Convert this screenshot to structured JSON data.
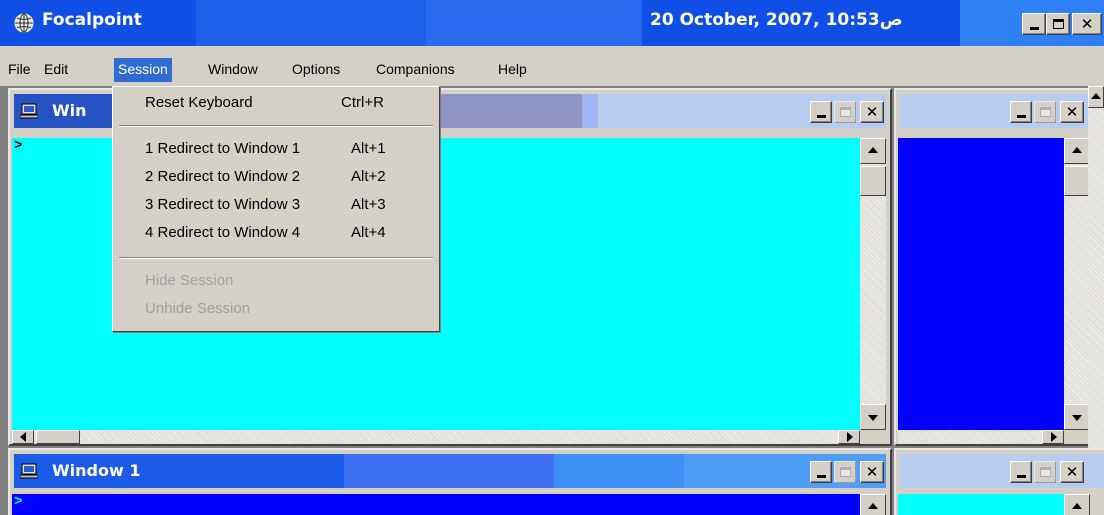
{
  "app": {
    "title": "Focalpoint",
    "clock": "20 October, 2007, ص10:53"
  },
  "menubar": {
    "items": [
      "File",
      "Edit",
      "Session",
      "Window",
      "Options",
      "Companions",
      "Help"
    ]
  },
  "session_menu": {
    "reset_keyboard": {
      "label": "Reset Keyboard",
      "shortcut": "Ctrl+R"
    },
    "redirects": [
      {
        "label": "1 Redirect to Window 1",
        "shortcut": "Alt+1"
      },
      {
        "label": "2 Redirect to Window 2",
        "shortcut": "Alt+2"
      },
      {
        "label": "3 Redirect to Window 3",
        "shortcut": "Alt+3"
      },
      {
        "label": "4 Redirect to Window 4",
        "shortcut": "Alt+4"
      }
    ],
    "hide_session": "Hide Session",
    "unhide_session": "Unhide Session"
  },
  "windows": {
    "top_left": {
      "title": "Win",
      "prompt": ">"
    },
    "bottom_left": {
      "title": "Window 1",
      "prompt": ">"
    }
  },
  "colors": {
    "title_blue": "#1c5be8",
    "cyan_client": "#00ffff",
    "blue_client": "#0000ff",
    "menu_highlight": "#306bd2"
  },
  "icons": [
    "focalpoint-globe-icon",
    "computer-icon",
    "minimize-icon",
    "maximize-icon",
    "close-icon",
    "scroll-arrow-icon"
  ]
}
